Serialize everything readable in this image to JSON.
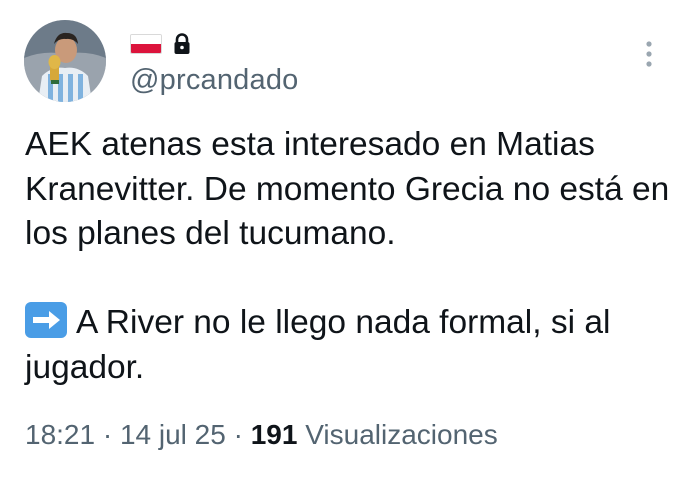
{
  "author": {
    "handle": "@prcandado",
    "icons": [
      "poland-flag-icon",
      "lock-icon"
    ],
    "verified_locked": true
  },
  "menu": {
    "icon": "more-vertical-icon"
  },
  "tweet": {
    "paragraph1": "AEK atenas esta interesado en Matias Kranevitter. De momento Grecia no está en los planes del tucumano.",
    "paragraph2_emoji": "right-arrow-emoji",
    "paragraph2": "A River no le llego nada formal, si al jugador."
  },
  "meta": {
    "time": "18:21",
    "separator1": " · ",
    "date": "14 jul 25",
    "separator2": " · ",
    "views_count": "191",
    "views_label": " Visualizaciones"
  },
  "colors": {
    "text": "#0f1419",
    "secondary": "#536471",
    "flag_red": "#dc143c",
    "emoji_blue": "#4a9de6"
  }
}
